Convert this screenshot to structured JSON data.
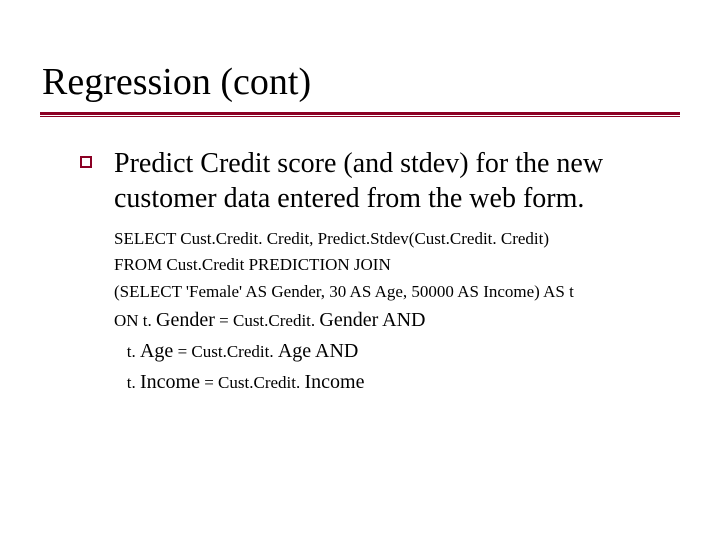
{
  "title": "Regression (cont)",
  "bullet": "Predict Credit score (and stdev) for the new customer data entered from the web form.",
  "sql": {
    "l1": "SELECT Cust.Credit. Credit, Predict.Stdev(Cust.Credit. Credit)",
    "l2": "FROM Cust.Credit PREDICTION JOIN",
    "l3": "(SELECT 'Female' AS Gender, 30 AS Age, 50000 AS Income) AS t",
    "l4a": "ON t. ",
    "l4b": "Gender",
    "l4c": " = Cust.Credit. ",
    "l4d": "Gender AND",
    "l5a": "   t. ",
    "l5b": "Age",
    "l5c": " = Cust.Credit. ",
    "l5d": "Age AND",
    "l6a": "   t. ",
    "l6b": "Income",
    "l6c": " = Cust.Credit. ",
    "l6d": "Income"
  }
}
